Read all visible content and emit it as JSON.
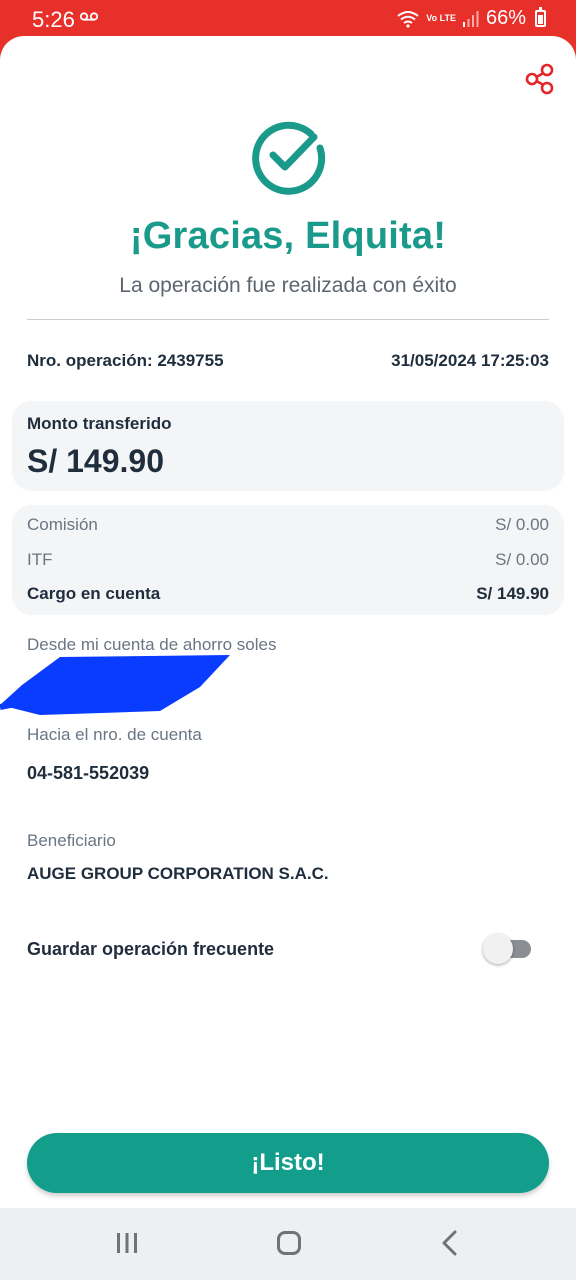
{
  "status_bar": {
    "time": "5:26",
    "battery": "66%",
    "voicemail_icon": "voicemail-icon",
    "wifi_icon": "wifi-icon",
    "network_label": "Vo LTE",
    "signal_icon": "signal-icon"
  },
  "header": {
    "share_icon": "share-icon",
    "success_icon": "check-circle-icon",
    "title": "¡Gracias, Elquita!",
    "subtitle": "La operación fue realizada con éxito"
  },
  "operation": {
    "number_label": "Nro. operación: 2439755",
    "datetime": "31/05/2024 17:25:03"
  },
  "amount": {
    "label": "Monto transferido",
    "value": "S/ 149.90"
  },
  "fees": [
    {
      "label": "Comisión",
      "value": "S/ 0.00"
    },
    {
      "label": "ITF",
      "value": "S/ 0.00"
    },
    {
      "label": "Cargo en cuenta",
      "value": "S/ 149.90"
    }
  ],
  "source": {
    "label": "Desde mi cuenta de ahorro soles"
  },
  "destination": {
    "label": "Hacia el nro. de cuenta",
    "value": "04-581-552039"
  },
  "beneficiary": {
    "label": "Beneficiario",
    "value": "AUGE GROUP CORPORATION S.A.C."
  },
  "frequent": {
    "label": "Guardar operación frecuente",
    "enabled": false
  },
  "actions": {
    "done_label": "¡Listo!"
  },
  "colors": {
    "brand_red": "#e8302a",
    "accent_teal": "#1a9a8a",
    "button_teal": "#139e8b",
    "redaction_blue": "#0a3cff"
  }
}
